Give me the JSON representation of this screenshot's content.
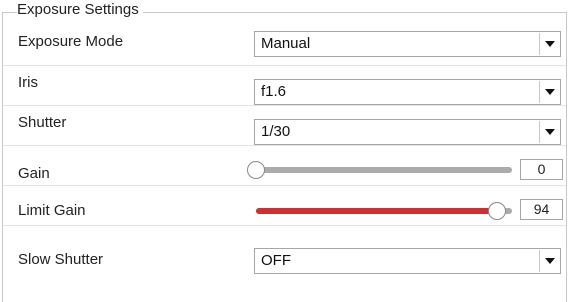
{
  "panel": {
    "title": "Exposure Settings",
    "accent_color": "#cf2f2f"
  },
  "exposure_mode": {
    "label": "Exposure Mode",
    "value": "Manual"
  },
  "iris": {
    "label": "Iris",
    "value": "f1.6"
  },
  "shutter": {
    "label": "Shutter",
    "value": "1/30"
  },
  "gain": {
    "label": "Gain",
    "value": "0",
    "level": 0.0
  },
  "limit_gain": {
    "label": "Limit Gain",
    "value": "94",
    "level": 0.94
  },
  "slow_shutter": {
    "label": "Slow Shutter",
    "value": "OFF"
  }
}
